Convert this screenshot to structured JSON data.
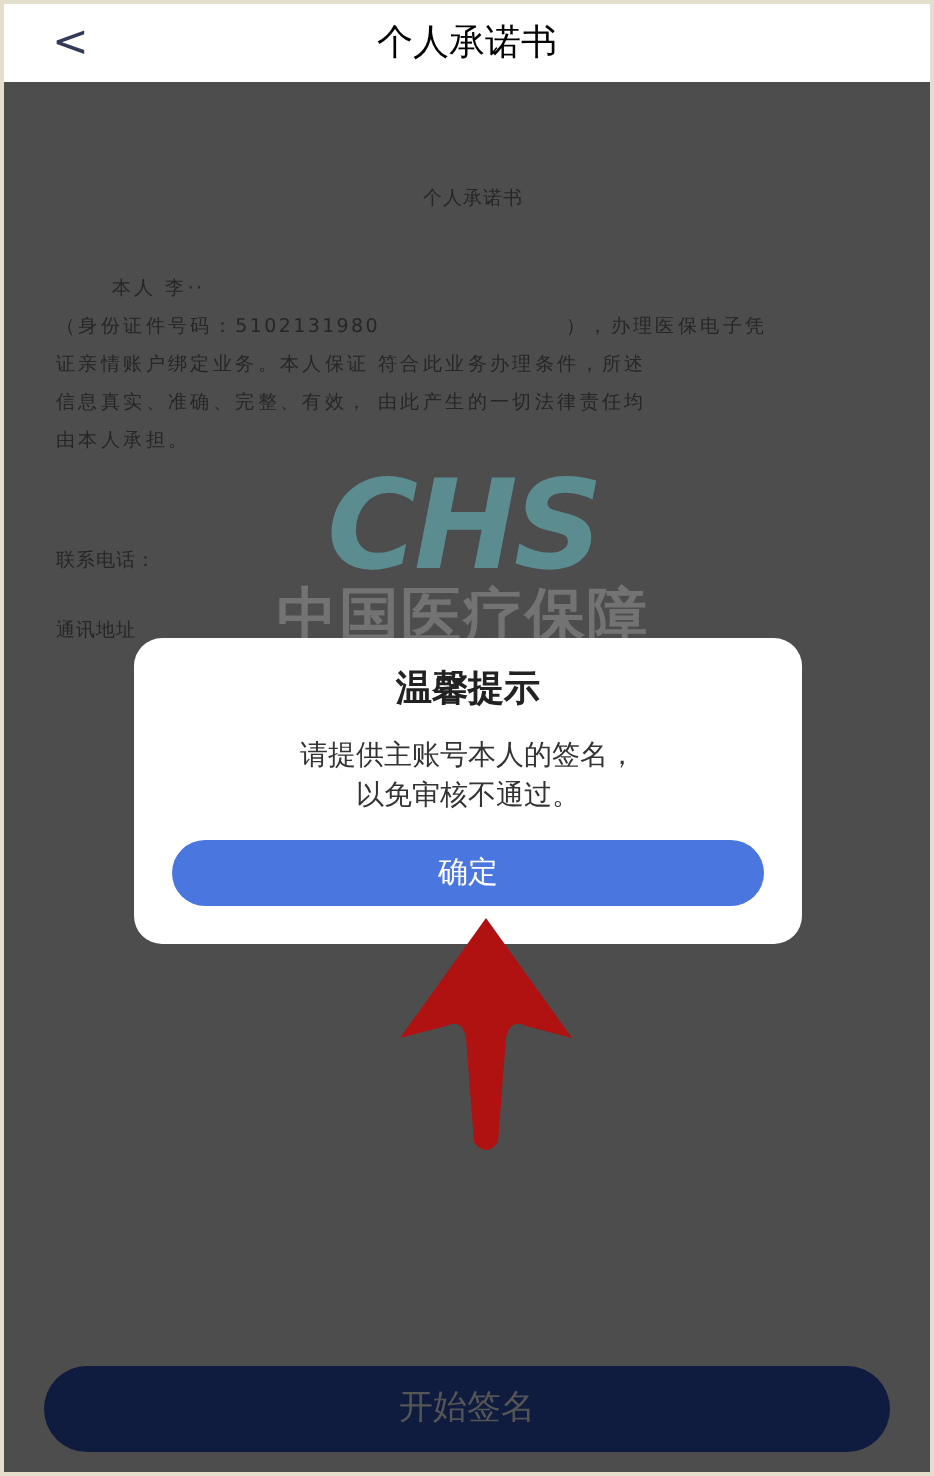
{
  "header": {
    "back": "<",
    "title": "个人承诺书"
  },
  "document": {
    "title": "个人承诺书",
    "lines": [
      "本人 李··",
      "（身份证件号码：5102131980                      ），办理医保电子凭",
      "证亲情账户绑定业务。本人保证 符合此业务办理条件，所述",
      "信息真实、准确、完整、有效， 由此产生的一切法律责任均",
      "由本人承担。"
    ],
    "watermark_logo": "CHS",
    "watermark_text": "中国医疗保障",
    "fields": [
      "联系电话：",
      "通讯地址"
    ]
  },
  "dialog": {
    "title": "温馨提示",
    "message_lines": [
      "请提供主账号本人的签名，",
      "以免审核不通过。"
    ],
    "button": "确定"
  },
  "bottom_button": {
    "label": "开始签名",
    "disabled": true
  }
}
